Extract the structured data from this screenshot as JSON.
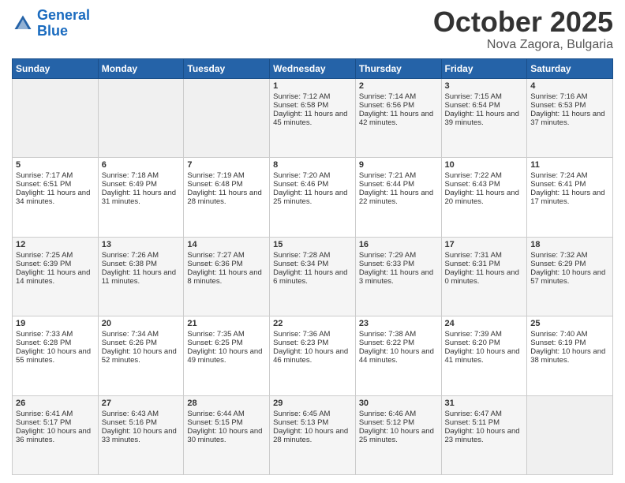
{
  "header": {
    "logo_line1": "General",
    "logo_line2": "Blue",
    "month": "October 2025",
    "location": "Nova Zagora, Bulgaria"
  },
  "weekdays": [
    "Sunday",
    "Monday",
    "Tuesday",
    "Wednesday",
    "Thursday",
    "Friday",
    "Saturday"
  ],
  "weeks": [
    [
      {
        "day": "",
        "info": ""
      },
      {
        "day": "",
        "info": ""
      },
      {
        "day": "",
        "info": ""
      },
      {
        "day": "1",
        "info": "Sunrise: 7:12 AM\nSunset: 6:58 PM\nDaylight: 11 hours and 45 minutes."
      },
      {
        "day": "2",
        "info": "Sunrise: 7:14 AM\nSunset: 6:56 PM\nDaylight: 11 hours and 42 minutes."
      },
      {
        "day": "3",
        "info": "Sunrise: 7:15 AM\nSunset: 6:54 PM\nDaylight: 11 hours and 39 minutes."
      },
      {
        "day": "4",
        "info": "Sunrise: 7:16 AM\nSunset: 6:53 PM\nDaylight: 11 hours and 37 minutes."
      }
    ],
    [
      {
        "day": "5",
        "info": "Sunrise: 7:17 AM\nSunset: 6:51 PM\nDaylight: 11 hours and 34 minutes."
      },
      {
        "day": "6",
        "info": "Sunrise: 7:18 AM\nSunset: 6:49 PM\nDaylight: 11 hours and 31 minutes."
      },
      {
        "day": "7",
        "info": "Sunrise: 7:19 AM\nSunset: 6:48 PM\nDaylight: 11 hours and 28 minutes."
      },
      {
        "day": "8",
        "info": "Sunrise: 7:20 AM\nSunset: 6:46 PM\nDaylight: 11 hours and 25 minutes."
      },
      {
        "day": "9",
        "info": "Sunrise: 7:21 AM\nSunset: 6:44 PM\nDaylight: 11 hours and 22 minutes."
      },
      {
        "day": "10",
        "info": "Sunrise: 7:22 AM\nSunset: 6:43 PM\nDaylight: 11 hours and 20 minutes."
      },
      {
        "day": "11",
        "info": "Sunrise: 7:24 AM\nSunset: 6:41 PM\nDaylight: 11 hours and 17 minutes."
      }
    ],
    [
      {
        "day": "12",
        "info": "Sunrise: 7:25 AM\nSunset: 6:39 PM\nDaylight: 11 hours and 14 minutes."
      },
      {
        "day": "13",
        "info": "Sunrise: 7:26 AM\nSunset: 6:38 PM\nDaylight: 11 hours and 11 minutes."
      },
      {
        "day": "14",
        "info": "Sunrise: 7:27 AM\nSunset: 6:36 PM\nDaylight: 11 hours and 8 minutes."
      },
      {
        "day": "15",
        "info": "Sunrise: 7:28 AM\nSunset: 6:34 PM\nDaylight: 11 hours and 6 minutes."
      },
      {
        "day": "16",
        "info": "Sunrise: 7:29 AM\nSunset: 6:33 PM\nDaylight: 11 hours and 3 minutes."
      },
      {
        "day": "17",
        "info": "Sunrise: 7:31 AM\nSunset: 6:31 PM\nDaylight: 11 hours and 0 minutes."
      },
      {
        "day": "18",
        "info": "Sunrise: 7:32 AM\nSunset: 6:29 PM\nDaylight: 10 hours and 57 minutes."
      }
    ],
    [
      {
        "day": "19",
        "info": "Sunrise: 7:33 AM\nSunset: 6:28 PM\nDaylight: 10 hours and 55 minutes."
      },
      {
        "day": "20",
        "info": "Sunrise: 7:34 AM\nSunset: 6:26 PM\nDaylight: 10 hours and 52 minutes."
      },
      {
        "day": "21",
        "info": "Sunrise: 7:35 AM\nSunset: 6:25 PM\nDaylight: 10 hours and 49 minutes."
      },
      {
        "day": "22",
        "info": "Sunrise: 7:36 AM\nSunset: 6:23 PM\nDaylight: 10 hours and 46 minutes."
      },
      {
        "day": "23",
        "info": "Sunrise: 7:38 AM\nSunset: 6:22 PM\nDaylight: 10 hours and 44 minutes."
      },
      {
        "day": "24",
        "info": "Sunrise: 7:39 AM\nSunset: 6:20 PM\nDaylight: 10 hours and 41 minutes."
      },
      {
        "day": "25",
        "info": "Sunrise: 7:40 AM\nSunset: 6:19 PM\nDaylight: 10 hours and 38 minutes."
      }
    ],
    [
      {
        "day": "26",
        "info": "Sunrise: 6:41 AM\nSunset: 5:17 PM\nDaylight: 10 hours and 36 minutes."
      },
      {
        "day": "27",
        "info": "Sunrise: 6:43 AM\nSunset: 5:16 PM\nDaylight: 10 hours and 33 minutes."
      },
      {
        "day": "28",
        "info": "Sunrise: 6:44 AM\nSunset: 5:15 PM\nDaylight: 10 hours and 30 minutes."
      },
      {
        "day": "29",
        "info": "Sunrise: 6:45 AM\nSunset: 5:13 PM\nDaylight: 10 hours and 28 minutes."
      },
      {
        "day": "30",
        "info": "Sunrise: 6:46 AM\nSunset: 5:12 PM\nDaylight: 10 hours and 25 minutes."
      },
      {
        "day": "31",
        "info": "Sunrise: 6:47 AM\nSunset: 5:11 PM\nDaylight: 10 hours and 23 minutes."
      },
      {
        "day": "",
        "info": ""
      }
    ]
  ]
}
